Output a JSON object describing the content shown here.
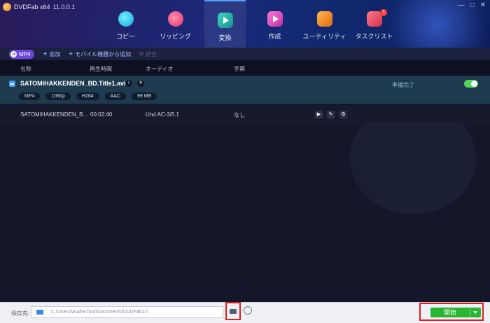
{
  "app": {
    "logo_text": "DVDFab x64",
    "version": "11.0.0.1"
  },
  "window_controls": [
    "—",
    "□",
    "✕"
  ],
  "nav": {
    "copy": "コピー",
    "rip": "リッピング",
    "convert": "変換",
    "create": "作成",
    "utility": "ユーティリティ",
    "tasks": "タスクリスト",
    "task_badge": "1"
  },
  "toolbar": {
    "format": "MP4",
    "add": "追加",
    "add_mobile": "モバイル機器から追加",
    "merge": "結合"
  },
  "columns": {
    "name": "名称",
    "duration": "再生時間",
    "audio": "オーディオ",
    "subtitle": "字幕"
  },
  "title": {
    "name": "SATOMIHAKKENDEN_BD.Title1.avi",
    "tags": [
      "MP4",
      "1080p",
      "H264",
      "AAC",
      "99 MB"
    ],
    "status": "準備完了"
  },
  "track": {
    "name": "SATOMIHAKKENDEN_B...",
    "duration": "00:02:40",
    "audio": "Und AC-3/5.1",
    "subtitle": "なし"
  },
  "footer": {
    "save_label": "保存先:",
    "path": "C:\\Users\\wudhe.hou\\Documents\\DVDFab11\\",
    "start": "開始"
  },
  "colors": {
    "accent": "#4fa3ff",
    "start_green": "#27b532",
    "highlight_red": "#e01f1f",
    "toggle_green": "#55d45b"
  }
}
